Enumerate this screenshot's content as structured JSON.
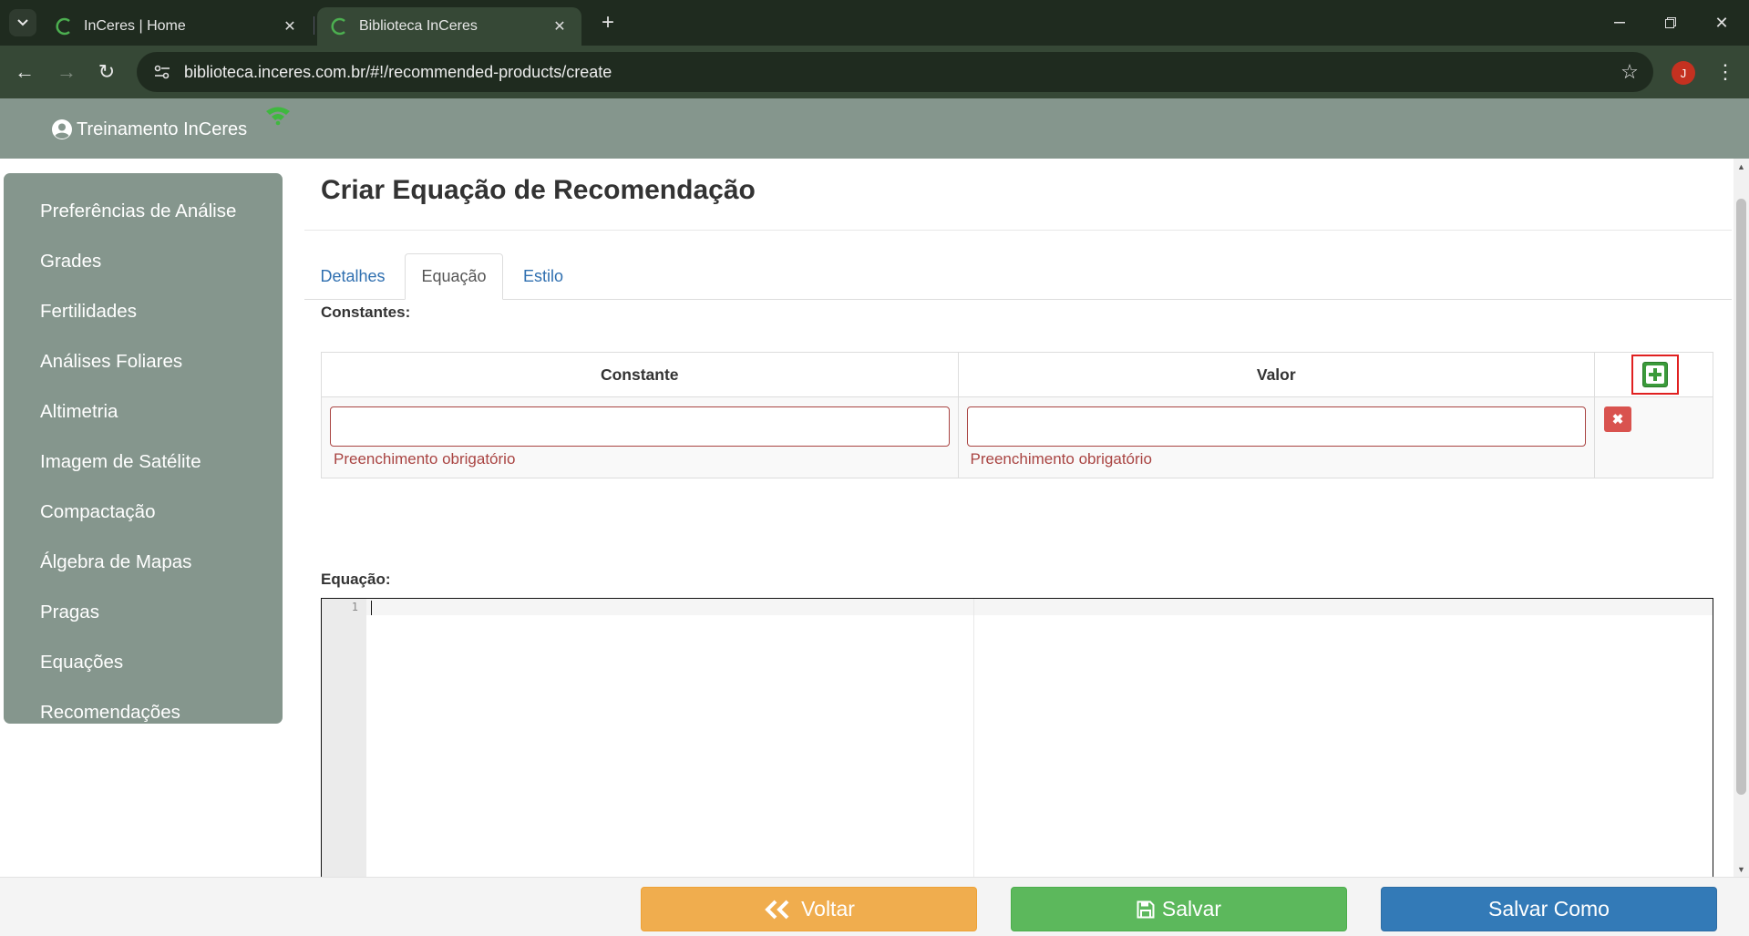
{
  "browser": {
    "tabs": [
      {
        "title": "InCeres | Home",
        "active": false
      },
      {
        "title": "Biblioteca InCeres",
        "active": true
      }
    ],
    "url": "biblioteca.inceres.com.br/#!/recommended-products/create",
    "profile_initial": "J"
  },
  "header": {
    "user_name": "Treinamento InCeres"
  },
  "sidebar": {
    "items": [
      {
        "label": "Preferências de Análise"
      },
      {
        "label": "Grades"
      },
      {
        "label": "Fertilidades"
      },
      {
        "label": "Análises Foliares"
      },
      {
        "label": "Altimetria"
      },
      {
        "label": "Imagem de Satélite"
      },
      {
        "label": "Compactação"
      },
      {
        "label": "Álgebra de Mapas"
      },
      {
        "label": "Pragas"
      },
      {
        "label": "Equações"
      },
      {
        "label": "Recomendações"
      }
    ]
  },
  "main": {
    "title": "Criar Equação de Recomendação",
    "tabs": [
      {
        "label": "Detalhes",
        "active": false
      },
      {
        "label": "Equação",
        "active": true
      },
      {
        "label": "Estilo",
        "active": false
      }
    ],
    "constants": {
      "label": "Constantes:",
      "columns": [
        "Constante",
        "Valor"
      ],
      "rows": [
        {
          "constante": "",
          "valor": "",
          "error_constante": "Preenchimento obrigatório",
          "error_valor": "Preenchimento obrigatório"
        }
      ]
    },
    "equation": {
      "label": "Equação:",
      "line_number": "1",
      "content": ""
    }
  },
  "footer": {
    "back_label": "Voltar",
    "save_label": "Salvar",
    "save_as_label": "Salvar Como"
  },
  "colors": {
    "header_bg": "#85968d",
    "chrome_dark": "#1f2b1f",
    "back_button": "#f0ad4e",
    "save_button": "#5cb85c",
    "save_as_button": "#337ab7",
    "error": "#a94442"
  }
}
